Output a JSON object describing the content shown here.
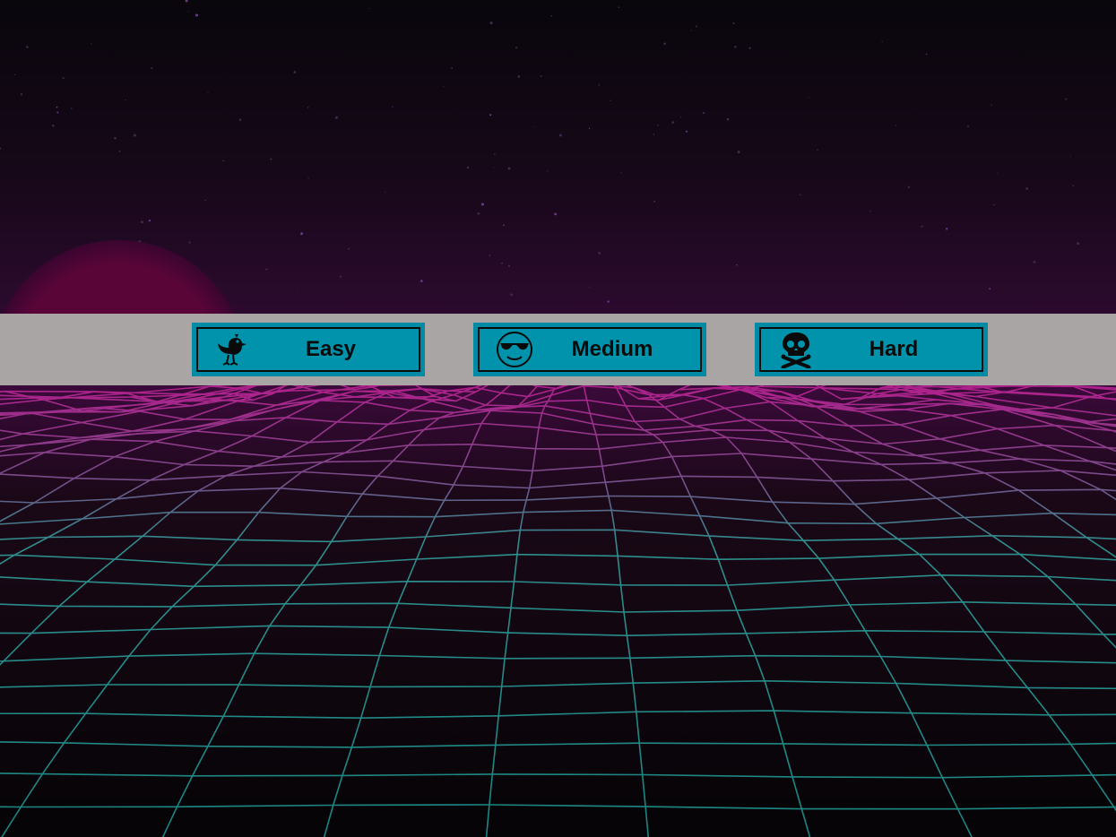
{
  "difficulty_menu": {
    "buttons": [
      {
        "id": "easy",
        "label": "Easy",
        "icon": "chick-icon"
      },
      {
        "id": "medium",
        "label": "Medium",
        "icon": "cool-face-icon"
      },
      {
        "id": "hard",
        "label": "Hard",
        "icon": "skull-crossbones-icon"
      }
    ]
  },
  "colors": {
    "sky_top": "#09060c",
    "sky_bottom": "#2a0a2c",
    "sun": "#5a0538",
    "grid_far": "#b0208c",
    "grid_near": "#1f8a87",
    "menu_bar": "#a8a5a4",
    "button_border": "#008aa3",
    "button_fill": "#0093ab"
  }
}
